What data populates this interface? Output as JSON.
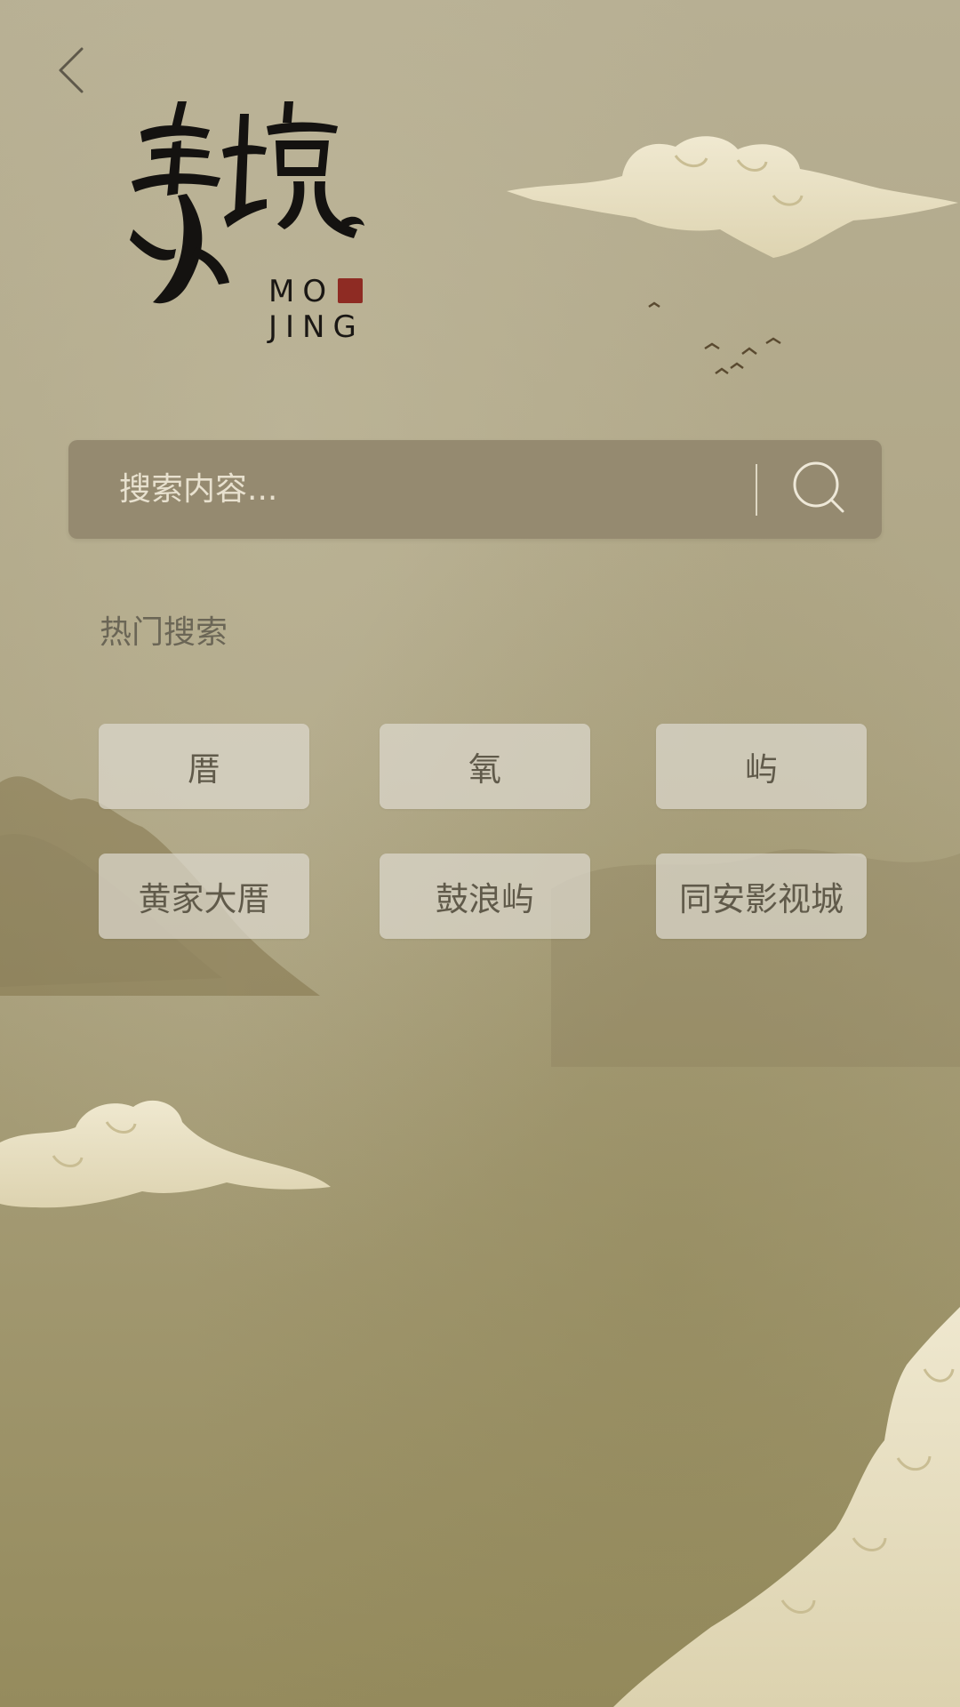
{
  "logo": {
    "chinese": "墨境",
    "english_line1": "MO",
    "english_line2": "JING"
  },
  "search": {
    "placeholder": "搜索内容...",
    "value": ""
  },
  "hot_search": {
    "title": "热门搜索",
    "tags": [
      "厝",
      "氧",
      "屿",
      "黄家大厝",
      "鼓浪屿",
      "同安影视城"
    ]
  },
  "colors": {
    "background": "#b3ab8d",
    "search_bar": "#958a70",
    "tag_background": "#dcd8cd",
    "text_primary": "#605a4a",
    "seal": "#8e2b23"
  },
  "icons": {
    "back": "chevron-left-icon",
    "search": "search-icon"
  }
}
